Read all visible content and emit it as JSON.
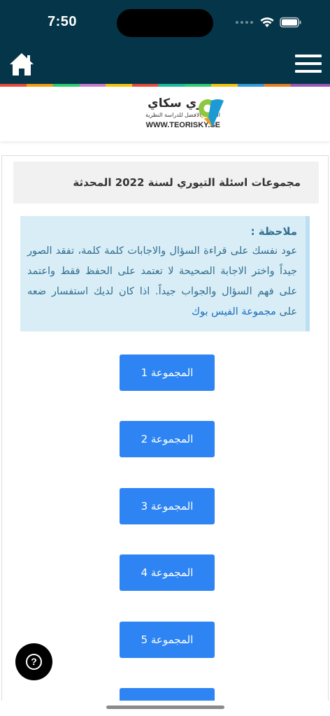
{
  "status_bar": {
    "time": "7:50",
    "icons": [
      "signal-dots-icon",
      "wifi-icon",
      "battery-icon"
    ]
  },
  "header": {
    "home_icon": "home-icon",
    "menu_icon": "hamburger-menu-icon",
    "background": "#053549"
  },
  "logo": {
    "name": "تيوري سكاي",
    "tagline": "الوسيلة الافضل للدراسة النظرية",
    "url": "WWW.TEORISKY.SE"
  },
  "page": {
    "title": "مجموعات اسئلة التيوري لسنة 2022 المحدثة"
  },
  "note": {
    "title": "ملاحظة :",
    "body": "عود نفسك على قراءة السؤال والاجابات كلمة كلمة، تفقد الصور جيداً واختر الاجابة الصحيحة لا تعتمد على الحفظ فقط واعتمد على فهم السؤال والجواب جيداً. اذا كان لديك استفسار ضعه على ",
    "link": "مجموعة الفيس بوك"
  },
  "groups": [
    {
      "label": "المجموعة 1"
    },
    {
      "label": "المجموعة 2"
    },
    {
      "label": "المجموعة 3"
    },
    {
      "label": "المجموعة 4"
    },
    {
      "label": "المجموعة 5"
    }
  ],
  "help_button": {
    "icon": "help-question-icon",
    "symbol": "?"
  },
  "colors": {
    "accent": "#2d84f2",
    "note_bg": "#d9edf7",
    "note_text": "#31708f"
  }
}
